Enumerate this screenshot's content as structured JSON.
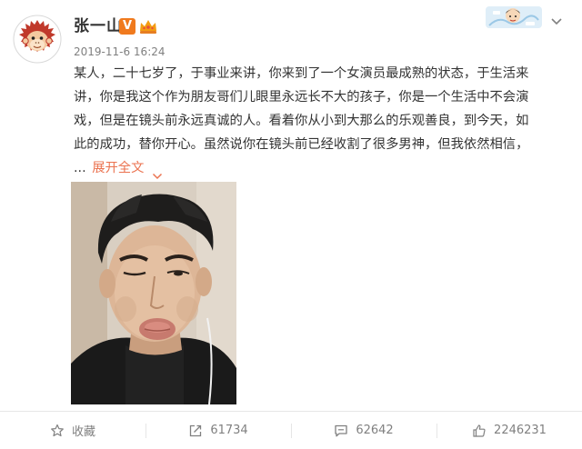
{
  "post": {
    "author": "张一山",
    "verified_badge": "V",
    "timestamp": "2019-11-6 16:24",
    "text_lines": [
      "某人，二十七岁了，于事业来讲，你来到了一个女演员最成熟的状态，于生活来",
      "讲，你是我这个作为朋友哥们儿眼里永远长不大的孩子，你是一个生活中不会演",
      "戏，但是在镜头前永远真诚的人。看着你从小到大那么的乐观善良，到今天，如",
      "此的成功，替你开心。虽然说你在镜头前已经收割了很多男神，但我依然相信，"
    ],
    "ellipsis": "...",
    "expand_label": "展开全文",
    "icons": {
      "avatar": "monkey-avatar-icon",
      "crown": "crown-icon",
      "sticker": "cartoon-sticker-icon",
      "dropdown": "chevron-down-icon"
    }
  },
  "actions": [
    {
      "label": "收藏",
      "icon": "star-icon"
    },
    {
      "label": "61734",
      "icon": "share-icon"
    },
    {
      "label": "62642",
      "icon": "comment-icon"
    },
    {
      "label": "2246231",
      "icon": "like-icon"
    }
  ],
  "colors": {
    "accent": "#eb7350",
    "badge": "#f07a1e",
    "muted": "#808080",
    "text": "#333333"
  }
}
